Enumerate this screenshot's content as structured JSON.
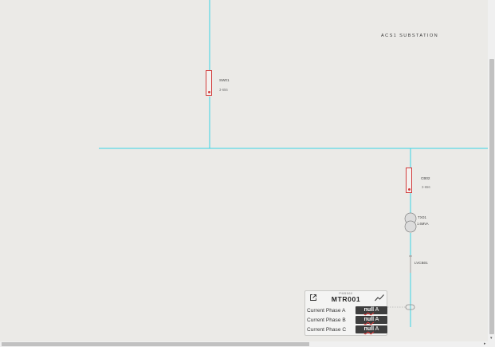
{
  "diagram": {
    "title": "ACS1 SUBSTATION",
    "devices": [
      {
        "name": "SW01",
        "sub": "3-656"
      },
      {
        "name": "CB02",
        "sub": "3-656"
      },
      {
        "name": "TX01",
        "sub": "1.6MVA"
      },
      {
        "name": "LVCB01",
        "sub": ""
      }
    ]
  },
  "meter": {
    "type": "PM5560",
    "name": "MTR001",
    "rows": [
      {
        "label": "Current Phase A",
        "value": "null",
        "unit": "A"
      },
      {
        "label": "Current Phase B",
        "value": "null",
        "unit": "A"
      },
      {
        "label": "Current Phase C",
        "value": "null",
        "unit": "A"
      }
    ]
  },
  "colors": {
    "bus": "#38d4e6",
    "breaker": "#d23c3c",
    "background": "#ebeae7"
  }
}
